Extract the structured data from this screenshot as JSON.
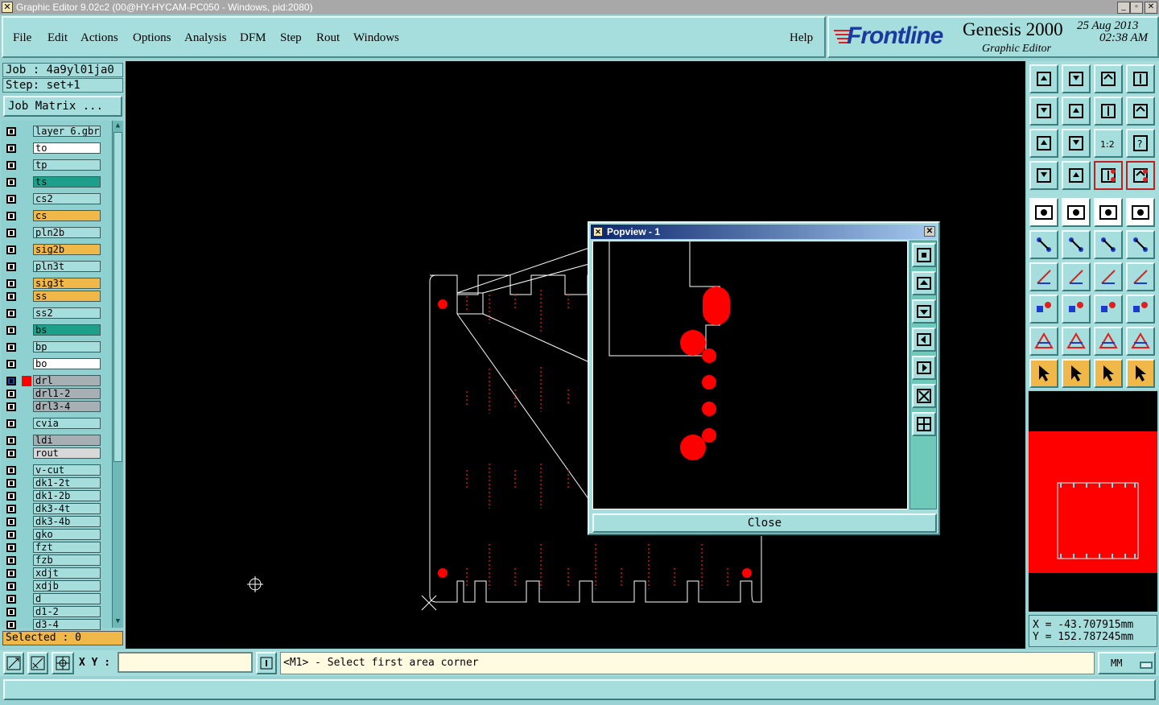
{
  "window": {
    "title": "Graphic Editor 9.02c2 (00@HY-HYCAM-PC050 - Windows, pid:2080)"
  },
  "menu": {
    "file": "File",
    "edit": "Edit",
    "actions": "Actions",
    "options": "Options",
    "analysis": "Analysis",
    "dfm": "DFM",
    "step": "Step",
    "rout": "Rout",
    "windows": "Windows",
    "help": "Help"
  },
  "logo": {
    "brand": "Frontline",
    "product": "Genesis 2000",
    "subtitle": "Graphic Editor",
    "date": "25 Aug 2013",
    "time": "02:38 AM"
  },
  "job": {
    "job_label": "Job : 4a9yl01ja0",
    "step_label": "Step: set+1",
    "matrix_button": "Job Matrix ..."
  },
  "layers": [
    {
      "name": "layer_6.gbr",
      "color": "#a6dede"
    },
    {
      "name": "to",
      "color": "#ffffff"
    },
    {
      "name": "tp",
      "color": "#a6dede"
    },
    {
      "name": "ts",
      "color": "#1ca08c"
    },
    {
      "name": "cs2",
      "color": "#a6dede"
    },
    {
      "name": "cs",
      "color": "#f0b848"
    },
    {
      "name": "pln2b",
      "color": "#a6dede"
    },
    {
      "name": "sig2b",
      "color": "#f0b848"
    },
    {
      "name": "pln3t",
      "color": "#a6dede"
    },
    {
      "name": "sig3t",
      "color": "#f0b848"
    },
    {
      "name": "ss",
      "color": "#f0b848"
    },
    {
      "name": "ss2",
      "color": "#a6dede"
    },
    {
      "name": "bs",
      "color": "#1ca08c"
    },
    {
      "name": "bp",
      "color": "#a6dede"
    },
    {
      "name": "bo",
      "color": "#ffffff"
    },
    {
      "name": "drl",
      "color": "#a6b0b4"
    },
    {
      "name": "drl1-2",
      "color": "#a6b0b4"
    },
    {
      "name": "drl3-4",
      "color": "#a6b0b4"
    },
    {
      "name": "cvia",
      "color": "#a6dede"
    },
    {
      "name": "ldi",
      "color": "#a6b0b4"
    },
    {
      "name": "rout",
      "color": "#d8d8d8"
    },
    {
      "name": "v-cut",
      "color": "#a6dede"
    },
    {
      "name": "dk1-2t",
      "color": "#a6dede"
    },
    {
      "name": "dk1-2b",
      "color": "#a6dede"
    },
    {
      "name": "dk3-4t",
      "color": "#a6dede"
    },
    {
      "name": "dk3-4b",
      "color": "#a6dede"
    },
    {
      "name": "gko",
      "color": "#a6dede"
    },
    {
      "name": "fzt",
      "color": "#a6dede"
    },
    {
      "name": "fzb",
      "color": "#a6dede"
    },
    {
      "name": "xdjt",
      "color": "#a6dede"
    },
    {
      "name": "xdjb",
      "color": "#a6dede"
    },
    {
      "name": "d",
      "color": "#a6dede"
    },
    {
      "name": "d1-2",
      "color": "#a6dede"
    },
    {
      "name": "d3-4",
      "color": "#a6dede"
    }
  ],
  "selected": {
    "label": "Selected : 0"
  },
  "popview": {
    "title": "Popview - 1",
    "close_label": "Close"
  },
  "coords": {
    "x": "X = -43.707915mm",
    "y": "Y = 152.787245mm"
  },
  "status": {
    "xy_label": "X Y :",
    "xy_value": "",
    "message": "<M1> - Select first area corner",
    "units": "MM"
  },
  "colors": {
    "panel": "#a6dede",
    "canvas": "#000000",
    "feature": "#ff0000",
    "profile": "#ffffff"
  }
}
